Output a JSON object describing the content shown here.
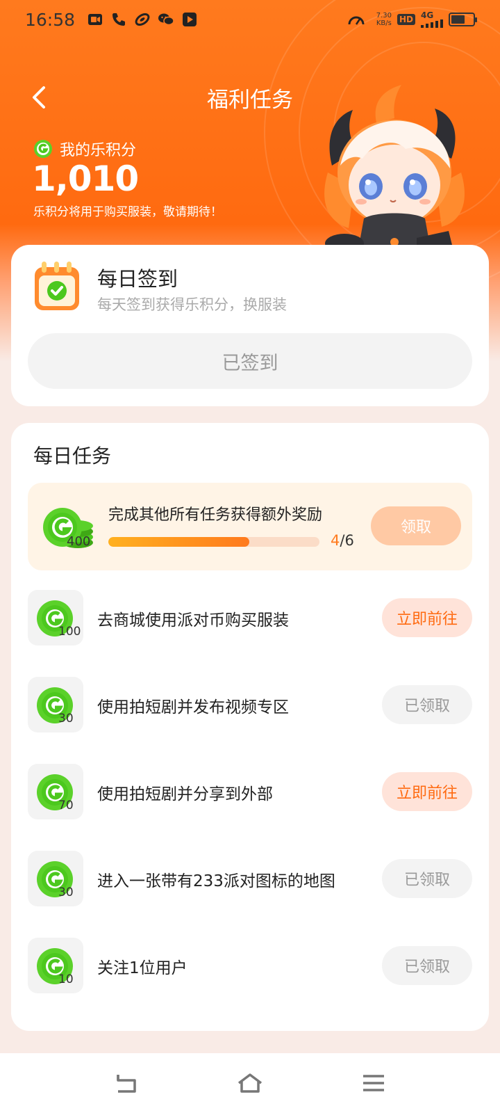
{
  "status_bar": {
    "time": "16:58",
    "net_speed_value": "7.30",
    "net_speed_unit": "KB/s",
    "hd_badge": "HD",
    "network": "4G",
    "icons": [
      "video-call-icon",
      "phone-icon",
      "link-icon",
      "wechat-icon",
      "media-icon",
      "speed-gauge-icon",
      "signal-icon",
      "battery-icon"
    ]
  },
  "header": {
    "title": "福利任务",
    "back_icon": "back-arrow-icon"
  },
  "points": {
    "label": "我的乐积分",
    "value": "1,010",
    "note": "乐积分将用于购买服装，敬请期待！"
  },
  "checkin": {
    "title": "每日签到",
    "subtitle": "每天签到获得乐积分，换服装",
    "button": "已签到"
  },
  "daily_tasks": {
    "title": "每日任务",
    "bonus": {
      "text": "完成其他所有任务获得额外奖励",
      "points": "400",
      "progress_done": "4",
      "progress_total": "/6",
      "progress_fraction": 0.667,
      "button": "领取"
    },
    "items": [
      {
        "points": "100",
        "label": "去商城使用派对币购买服装",
        "button": "立即前往",
        "state": "go"
      },
      {
        "points": "30",
        "label": "使用拍短剧并发布视频专区",
        "button": "已领取",
        "state": "done"
      },
      {
        "points": "70",
        "label": "使用拍短剧并分享到外部",
        "button": "立即前往",
        "state": "go"
      },
      {
        "points": "30",
        "label": "进入一张带有233派对图标的地图",
        "button": "已领取",
        "state": "done"
      },
      {
        "points": "10",
        "label": "关注1位用户",
        "button": "已领取",
        "state": "done"
      }
    ]
  },
  "colors": {
    "brand_orange": "#ff7a1e",
    "coin_green": "#4cc81e",
    "page_bg": "#f9ebe6"
  }
}
